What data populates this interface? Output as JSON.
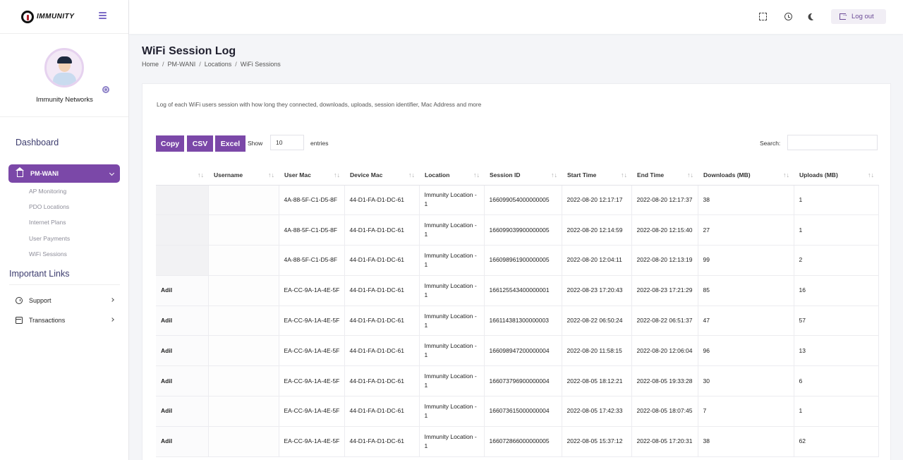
{
  "app": {
    "logo_text": "IMMUNITY",
    "logout_label": "Log out"
  },
  "sidebar": {
    "profile_name": "Immunity Networks",
    "dashboard_label": "Dashboard",
    "active_item": "PM-WANI",
    "sub_items": [
      "AP Monitoring",
      "PDO Locations",
      "Internet Plans",
      "User Payments",
      "WiFi Sessions"
    ],
    "important_links_title": "Important Links",
    "links": [
      "Support",
      "Transactions"
    ]
  },
  "page": {
    "title": "WiFi Session Log",
    "breadcrumb": [
      "Home",
      "PM-WANI",
      "Locations",
      "WiFi Sessions"
    ],
    "description": "Log of each WiFi users session with how long they connected, downloads, uploads, session identifier, Mac Address and more"
  },
  "controls": {
    "buttons": [
      "Copy",
      "CSV",
      "Excel"
    ],
    "show_label": "Show",
    "entries_value": "10",
    "entries_label": "entries",
    "search_label": "Search:"
  },
  "table": {
    "headers": [
      "",
      "Username",
      "User Mac",
      "Device Mac",
      "Location",
      "Session ID",
      "Start Time",
      "End Time",
      "Downloads (MB)",
      "Uploads (MB)"
    ],
    "rows": [
      {
        "name": "",
        "username": "",
        "user_mac": "4A-88-5F-C1-D5-8F",
        "device_mac": "44-D1-FA-D1-DC-61",
        "location": "Immunity Location - 1",
        "session_id": "166099054000000005",
        "start": "2022-08-20 12:17:17",
        "end": "2022-08-20 12:17:37",
        "downloads": "38",
        "uploads": "1"
      },
      {
        "name": "",
        "username": "",
        "user_mac": "4A-88-5F-C1-D5-8F",
        "device_mac": "44-D1-FA-D1-DC-61",
        "location": "Immunity Location - 1",
        "session_id": "166099039900000005",
        "start": "2022-08-20 12:14:59",
        "end": "2022-08-20 12:15:40",
        "downloads": "27",
        "uploads": "1"
      },
      {
        "name": "",
        "username": "",
        "user_mac": "4A-88-5F-C1-D5-8F",
        "device_mac": "44-D1-FA-D1-DC-61",
        "location": "Immunity Location - 1",
        "session_id": "166098961900000005",
        "start": "2022-08-20 12:04:11",
        "end": "2022-08-20 12:13:19",
        "downloads": "99",
        "uploads": "2"
      },
      {
        "name": "Adil",
        "username": "",
        "user_mac": "EA-CC-9A-1A-4E-5F",
        "device_mac": "44-D1-FA-D1-DC-61",
        "location": "Immunity Location - 1",
        "session_id": "166125543400000001",
        "start": "2022-08-23 17:20:43",
        "end": "2022-08-23 17:21:29",
        "downloads": "85",
        "uploads": "16"
      },
      {
        "name": "Adil",
        "username": "",
        "user_mac": "EA-CC-9A-1A-4E-5F",
        "device_mac": "44-D1-FA-D1-DC-61",
        "location": "Immunity Location - 1",
        "session_id": "166114381300000003",
        "start": "2022-08-22 06:50:24",
        "end": "2022-08-22 06:51:37",
        "downloads": "47",
        "uploads": "57"
      },
      {
        "name": "Adil",
        "username": "",
        "user_mac": "EA-CC-9A-1A-4E-5F",
        "device_mac": "44-D1-FA-D1-DC-61",
        "location": "Immunity Location - 1",
        "session_id": "166098947200000004",
        "start": "2022-08-20 11:58:15",
        "end": "2022-08-20 12:06:04",
        "downloads": "96",
        "uploads": "13"
      },
      {
        "name": "Adil",
        "username": "",
        "user_mac": "EA-CC-9A-1A-4E-5F",
        "device_mac": "44-D1-FA-D1-DC-61",
        "location": "Immunity Location - 1",
        "session_id": "166073796900000004",
        "start": "2022-08-05 18:12:21",
        "end": "2022-08-05 19:33:28",
        "downloads": "30",
        "uploads": "6"
      },
      {
        "name": "Adil",
        "username": "",
        "user_mac": "EA-CC-9A-1A-4E-5F",
        "device_mac": "44-D1-FA-D1-DC-61",
        "location": "Immunity Location - 1",
        "session_id": "166073615000000004",
        "start": "2022-08-05 17:42:33",
        "end": "2022-08-05 18:07:45",
        "downloads": "7",
        "uploads": "1"
      },
      {
        "name": "Adil",
        "username": "",
        "user_mac": "EA-CC-9A-1A-4E-5F",
        "device_mac": "44-D1-FA-D1-DC-61",
        "location": "Immunity Location - 1",
        "session_id": "166072866000000005",
        "start": "2022-08-05 15:37:12",
        "end": "2022-08-05 17:20:31",
        "downloads": "38",
        "uploads": "62"
      }
    ]
  }
}
